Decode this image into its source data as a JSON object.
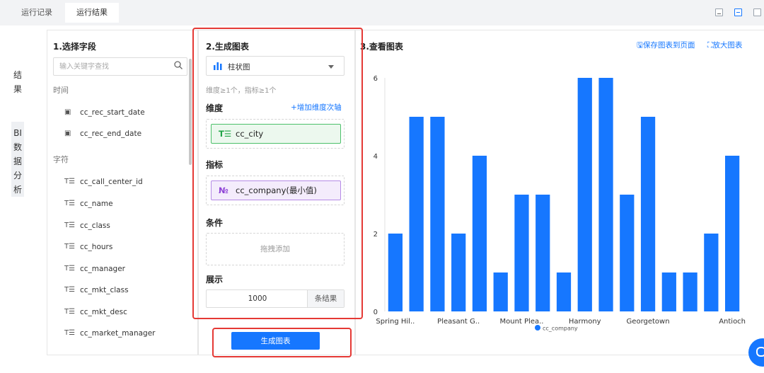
{
  "tabs": [
    {
      "label": "运行记录",
      "active": false
    },
    {
      "label": "运行结果",
      "active": true
    }
  ],
  "side_labels": {
    "result": "结果",
    "bi": "BI数据分析"
  },
  "field_panel": {
    "title": "1.选择字段",
    "search_placeholder": "输入关键字查找",
    "groups": [
      {
        "label": "时间",
        "fields": [
          "cc_rec_start_date",
          "cc_rec_end_date"
        ]
      },
      {
        "label": "字符",
        "fields": [
          "cc_call_center_id",
          "cc_name",
          "cc_class",
          "cc_hours",
          "cc_manager",
          "cc_mkt_class",
          "cc_mkt_desc",
          "cc_market_manager"
        ]
      }
    ]
  },
  "config_panel": {
    "title": "2.生成图表",
    "chart_type": "柱状图",
    "hint": "维度≥1个，指标≥1个",
    "dimension_label": "维度",
    "add_axis_label": "+增加维度次轴",
    "dimension_value": "cc_city",
    "metric_label": "指标",
    "metric_value": "cc_company(最小值)",
    "condition_label": "条件",
    "condition_placeholder": "拖拽添加",
    "display_label": "展示",
    "display_value": "1000",
    "display_unit": "条结果",
    "generate_button": "生成图表"
  },
  "view_panel": {
    "title": "3.查看图表",
    "save_link": "保存图表到页面",
    "zoom_link": "放大图表"
  },
  "icons": {
    "date": "calendar-icon",
    "text": "text-field-icon",
    "number": "number-field-icon",
    "search": "search-icon",
    "bar": "bar-chart-icon"
  },
  "colors": {
    "accent": "#1677ff",
    "highlight": "#e53935",
    "dimension": "#1fa446",
    "metric": "#8e44d6"
  },
  "chart_data": {
    "type": "bar",
    "categories": [
      "Spring Hil..",
      "",
      "",
      "Pleasant G..",
      "",
      "",
      "Mount Plea..",
      "",
      "",
      "Harmony",
      "",
      "",
      "Georgetown",
      "",
      "",
      "",
      "Antioch"
    ],
    "series": [
      {
        "name": "cc_company",
        "values": [
          2,
          5,
          5,
          2,
          4,
          1,
          3,
          3,
          1,
          6,
          6,
          3,
          5,
          1,
          1,
          2,
          4
        ]
      }
    ],
    "ylim": [
      0,
      6
    ],
    "yticks": [
      0,
      2,
      4,
      6
    ],
    "grid": false,
    "legend": "bottom",
    "color": "#1677ff"
  }
}
